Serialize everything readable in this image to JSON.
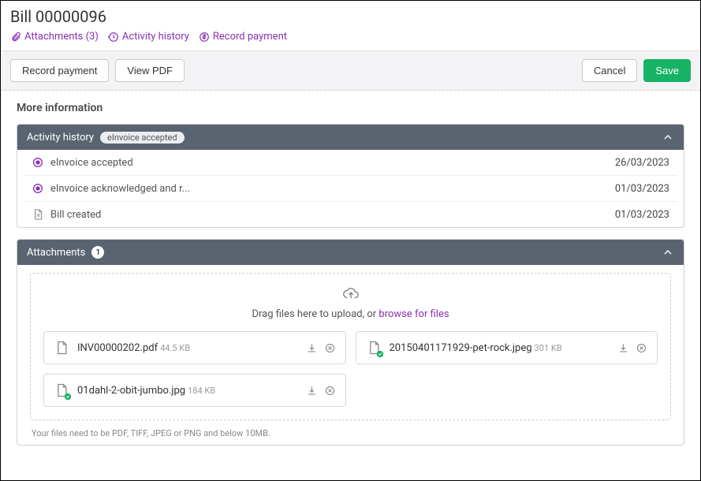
{
  "header": {
    "title": "Bill 00000096"
  },
  "toplinks": {
    "attachments": "Attachments (3)",
    "history": "Activity history",
    "payment": "Record payment"
  },
  "actions": {
    "record_payment": "Record payment",
    "view_pdf": "View PDF",
    "cancel": "Cancel",
    "save": "Save"
  },
  "section": {
    "more_info": "More information"
  },
  "history_panel": {
    "title": "Activity history",
    "badge": "eInvoice accepted",
    "items": [
      {
        "text": "eInvoice accepted",
        "date": "26/03/2023",
        "kind": "e"
      },
      {
        "text": "eInvoice acknowledged and r...",
        "date": "01/03/2023",
        "kind": "e"
      },
      {
        "text": "Bill created",
        "date": "01/03/2023",
        "kind": "doc"
      }
    ]
  },
  "attach_panel": {
    "title": "Attachments",
    "count": "1",
    "drag_text": "Drag files here to upload, or ",
    "browse": "browse for files",
    "files": [
      {
        "name": "INV00000202.pdf",
        "size": "44.5 KB",
        "verified": false
      },
      {
        "name": "20150401171929-pet-rock.jpeg",
        "size": "301 KB",
        "verified": true
      },
      {
        "name": "01dahl-2-obit-jumbo.jpg",
        "size": "184 KB",
        "verified": true
      }
    ],
    "hint": "Your files need to be PDF, TIFF, JPEG or PNG and below 10MB."
  }
}
